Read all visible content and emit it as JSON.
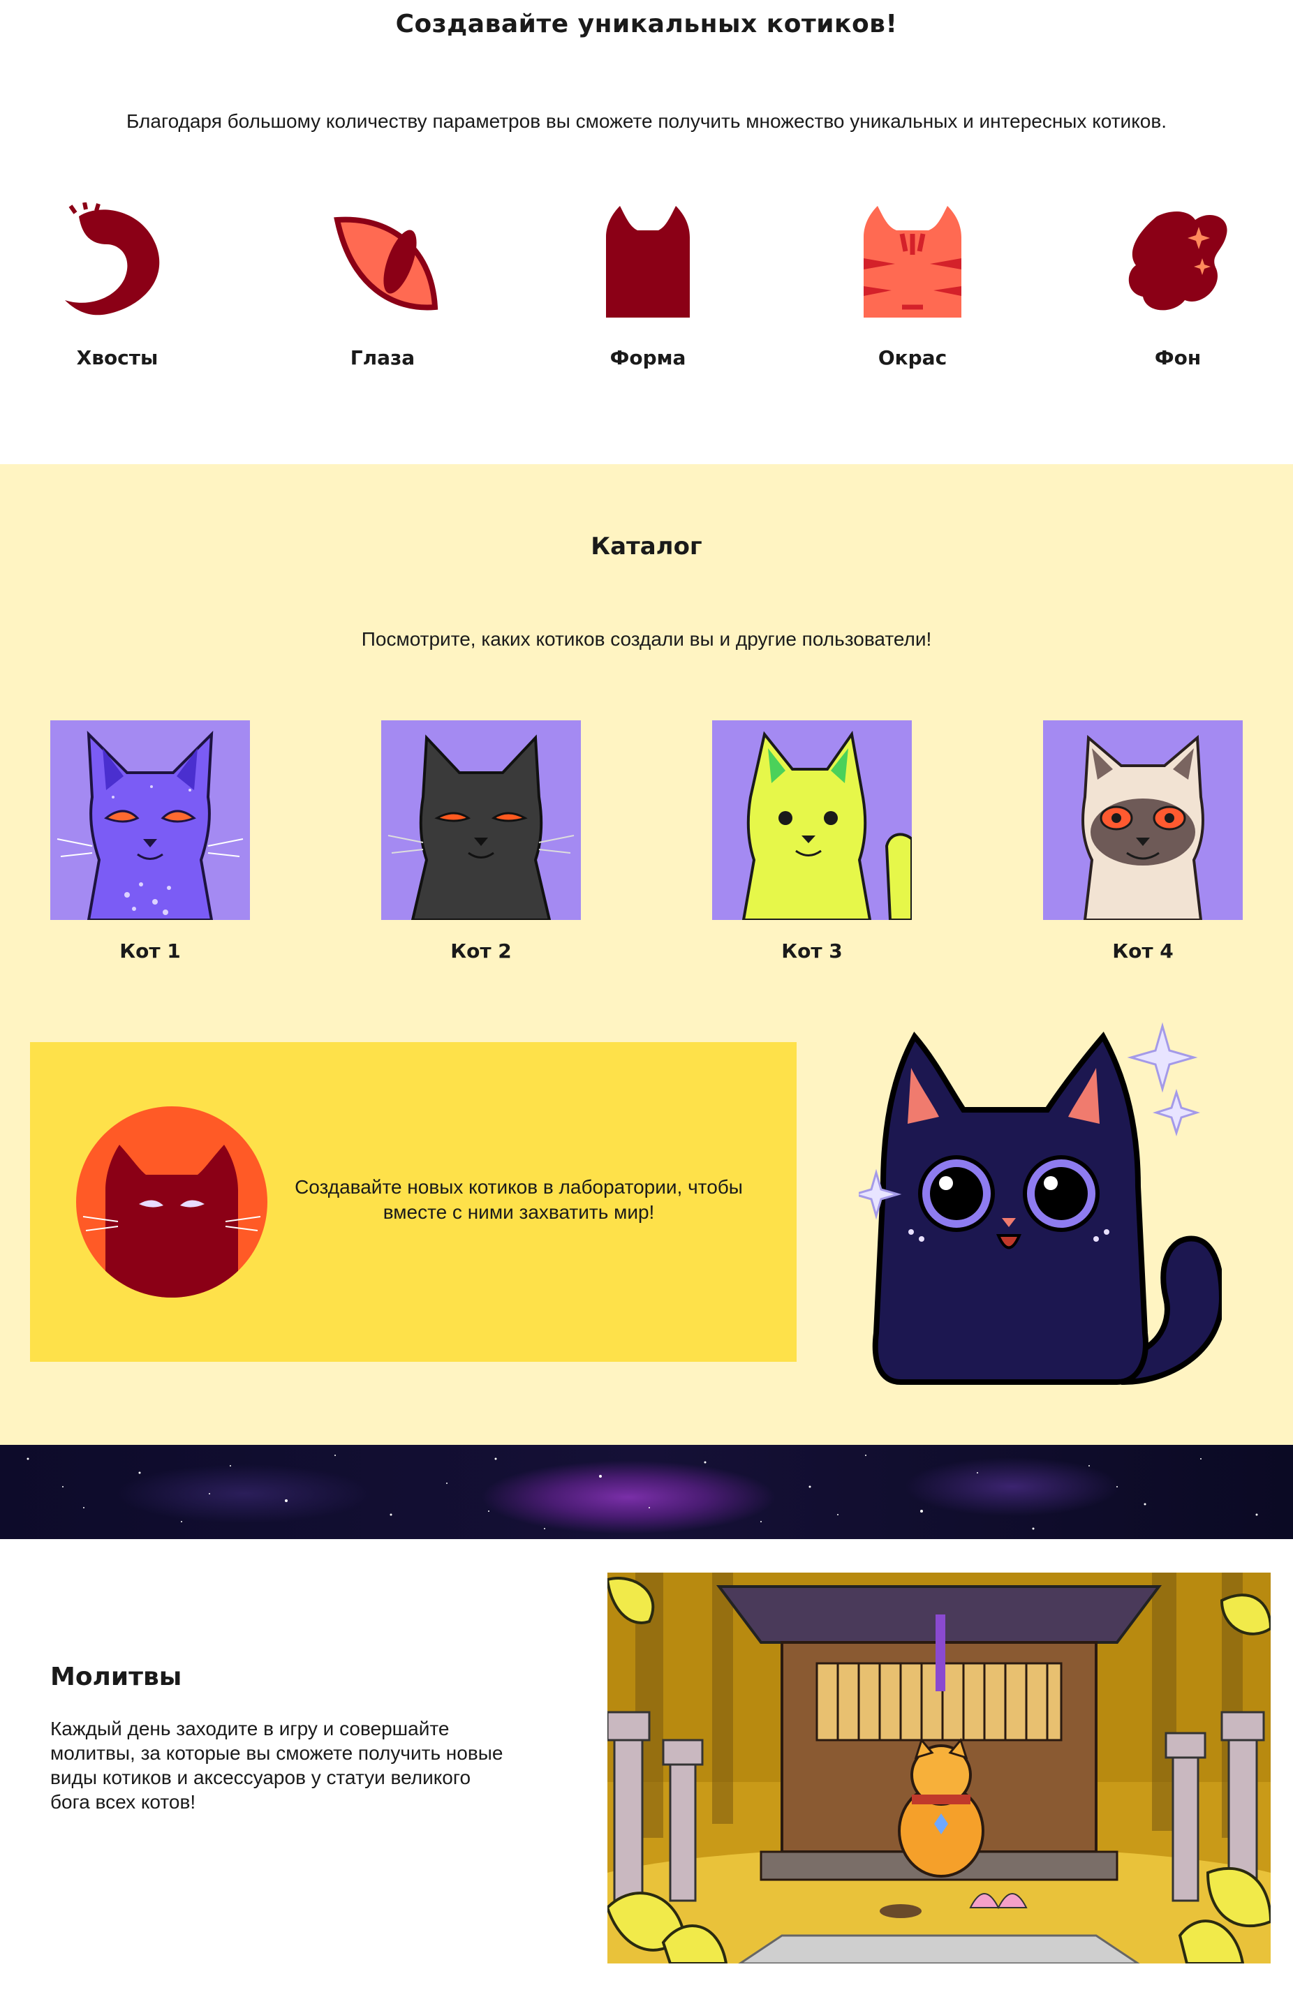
{
  "features": {
    "title": "Создавайте уникальных котиков!",
    "lead": "Благодаря большому количеству параметров вы сможете получить множество уникальных и интересных котиков.",
    "items": [
      {
        "label": "Хвосты",
        "icon": "tail-icon"
      },
      {
        "label": "Глаза",
        "icon": "eye-icon"
      },
      {
        "label": "Форма",
        "icon": "cat-shape-icon"
      },
      {
        "label": "Окрас",
        "icon": "cat-color-icon"
      },
      {
        "label": "Фон",
        "icon": "background-icon"
      }
    ],
    "icon_color": "#8b0016"
  },
  "catalog": {
    "title": "Каталог",
    "lead": "Посмотрите, каких котиков создали вы и другие пользователи!",
    "cards": [
      {
        "label": "Кот 1"
      },
      {
        "label": "Кот 2"
      },
      {
        "label": "Кот 3"
      },
      {
        "label": "Кот 4"
      }
    ],
    "card_bg": "#a48af2",
    "promo_text": "Создавайте новых котиков в лаборатории, чтобы вместе с ними захватить мир!",
    "section_bg": "#fff4c2",
    "promo_bg": "#fee14a"
  },
  "prayers": {
    "title": "Молитвы",
    "text": "Каждый день заходите в игру и совершайте молитвы, за которые вы сможете получить новые виды котиков и аксессуаров у статуи великого бога всех котов!"
  }
}
